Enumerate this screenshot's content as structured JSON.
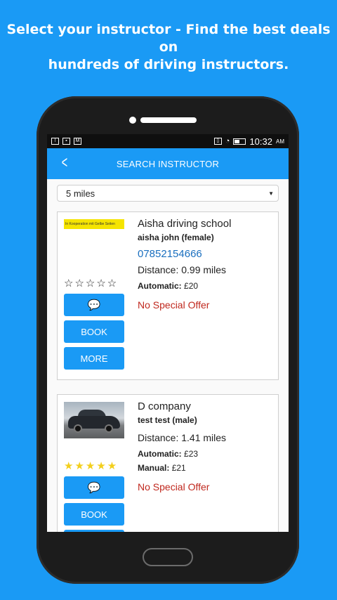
{
  "headline": {
    "line1": "Select your instructor - Find the best deals on",
    "line2": "hundreds of driving instructors."
  },
  "statusbar": {
    "time": "10:32",
    "ampm": "AM"
  },
  "appbar": {
    "title": "SEARCH INSTRUCTOR"
  },
  "filter": {
    "distance_selected": "5 miles"
  },
  "instructors": [
    {
      "logo_text": "In Kooperation mit Gelbe Seiten",
      "school": "Aisha driving school",
      "instructor": "aisha john (female)",
      "phone": "07852154666",
      "distance": "Distance: 0.99 miles",
      "automatic_label": "Automatic:",
      "automatic_price": "£20",
      "offer": "No Special Offer",
      "rating": "☆☆☆☆☆",
      "book_label": "BOOK",
      "more_label": "MORE"
    },
    {
      "school": "D company",
      "instructor": "test test (male)",
      "distance": "Distance: 1.41 miles",
      "automatic_label": "Automatic:",
      "automatic_price": "£23",
      "manual_label": "Manual:",
      "manual_price": "£21",
      "offer": "No Special Offer",
      "rating": "★★★★★",
      "book_label": "BOOK"
    }
  ],
  "colors": {
    "accent": "#1a9af5",
    "offer_red": "#c0281e",
    "link_blue": "#1a6fbf",
    "star_gold": "#f3cf1c"
  }
}
